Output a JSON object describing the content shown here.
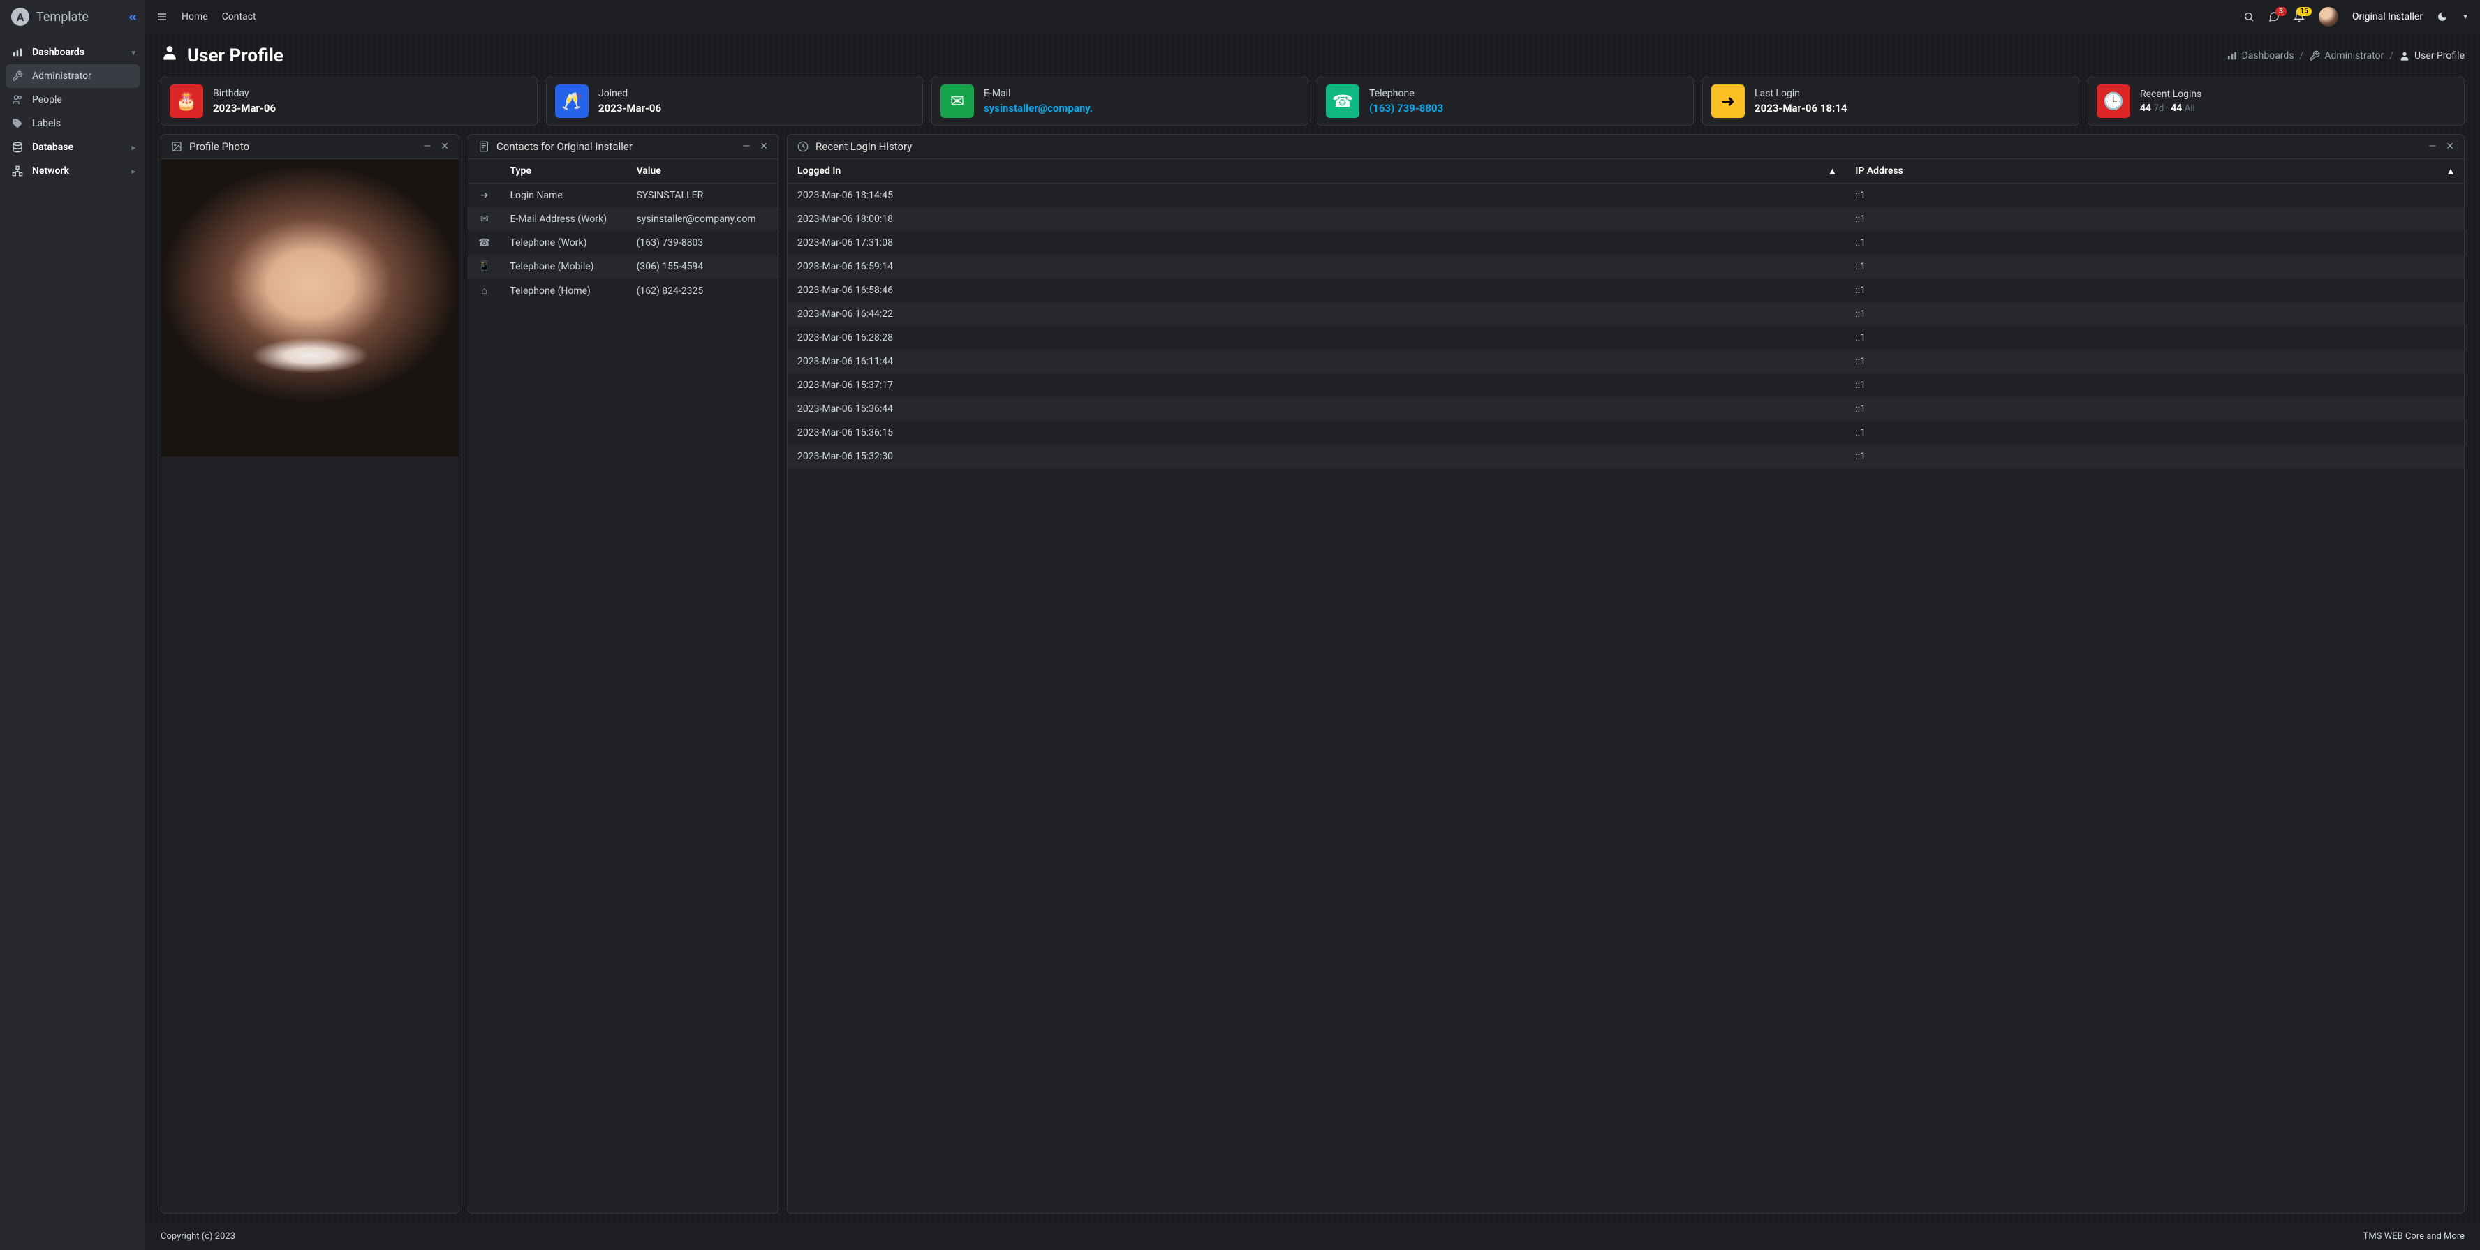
{
  "brand": "Template",
  "topnav": {
    "home": "Home",
    "contact": "Contact"
  },
  "notifications": {
    "chat": "3",
    "bell": "15"
  },
  "user": {
    "name": "Original Installer"
  },
  "sidebar": {
    "sections": [
      {
        "label": "Dashboards",
        "icon": "chart-bar",
        "expandable": true,
        "active_parent": true,
        "children": [
          {
            "label": "Administrator",
            "icon": "tools",
            "active": true
          },
          {
            "label": "People",
            "icon": "users"
          },
          {
            "label": "Labels",
            "icon": "tag"
          }
        ]
      },
      {
        "label": "Database",
        "icon": "database",
        "expandable": true
      },
      {
        "label": "Network",
        "icon": "network",
        "expandable": true
      }
    ]
  },
  "page": {
    "title": "User Profile",
    "breadcrumbs": [
      {
        "icon": "chart-bar",
        "label": "Dashboards"
      },
      {
        "icon": "tools",
        "label": "Administrator"
      },
      {
        "icon": "user",
        "label": "User Profile",
        "current": true
      }
    ]
  },
  "stats": [
    {
      "color": "red",
      "icon": "🎂",
      "label": "Birthday",
      "value": "2023-Mar-06"
    },
    {
      "color": "blue",
      "icon": "🥂",
      "label": "Joined",
      "value": "2023-Mar-06"
    },
    {
      "color": "green",
      "icon": "✉",
      "label": "E-Mail",
      "value": "sysinstaller@company.",
      "link": true
    },
    {
      "color": "teal",
      "icon": "☎",
      "label": "Telephone",
      "value": "(163) 739-8803",
      "link": true
    },
    {
      "color": "yellow",
      "icon": "➜",
      "label": "Last Login",
      "value": "2023-Mar-06 18:14"
    },
    {
      "color": "red",
      "icon": "🕒",
      "label": "Recent Logins",
      "multi": [
        {
          "v": "44",
          "suffix": "7d"
        },
        {
          "v": "44",
          "suffix": "All"
        }
      ]
    }
  ],
  "panels": {
    "photo": {
      "title": "Profile Photo"
    },
    "contacts": {
      "title": "Contacts for Original Installer",
      "headers": [
        "",
        "Type",
        "Value"
      ],
      "rows": [
        {
          "icon": "➜",
          "type": "Login Name",
          "value": "SYSINSTALLER"
        },
        {
          "icon": "✉",
          "type": "E-Mail Address (Work)",
          "value": "sysinstaller@company.com"
        },
        {
          "icon": "☎",
          "type": "Telephone (Work)",
          "value": "(163) 739-8803"
        },
        {
          "icon": "📱",
          "type": "Telephone (Mobile)",
          "value": "(306) 155-4594"
        },
        {
          "icon": "⌂",
          "type": "Telephone (Home)",
          "value": "(162) 824-2325"
        }
      ]
    },
    "history": {
      "title": "Recent Login History",
      "headers": {
        "logged_in": "Logged In",
        "ip": "IP Address"
      },
      "rows": [
        {
          "time": "2023-Mar-06 18:14:45",
          "ip": "::1"
        },
        {
          "time": "2023-Mar-06 18:00:18",
          "ip": "::1"
        },
        {
          "time": "2023-Mar-06 17:31:08",
          "ip": "::1"
        },
        {
          "time": "2023-Mar-06 16:59:14",
          "ip": "::1"
        },
        {
          "time": "2023-Mar-06 16:58:46",
          "ip": "::1"
        },
        {
          "time": "2023-Mar-06 16:44:22",
          "ip": "::1"
        },
        {
          "time": "2023-Mar-06 16:28:28",
          "ip": "::1"
        },
        {
          "time": "2023-Mar-06 16:11:44",
          "ip": "::1"
        },
        {
          "time": "2023-Mar-06 15:37:17",
          "ip": "::1"
        },
        {
          "time": "2023-Mar-06 15:36:44",
          "ip": "::1"
        },
        {
          "time": "2023-Mar-06 15:36:15",
          "ip": "::1"
        },
        {
          "time": "2023-Mar-06 15:32:30",
          "ip": "::1"
        }
      ]
    }
  },
  "footer": {
    "left": "Copyright (c) 2023",
    "right": "TMS WEB Core and More"
  }
}
